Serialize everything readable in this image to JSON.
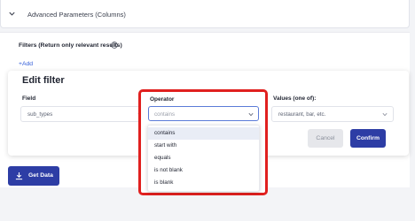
{
  "advanced_parameters": {
    "label": "Advanced Parameters (Columns)"
  },
  "filters": {
    "title": "Filters (Return only relevant results)",
    "add_label": "+Add"
  },
  "modal": {
    "title": "Edit filter",
    "field": {
      "label": "Field",
      "value": "sub_types"
    },
    "operator": {
      "label": "Operator",
      "placeholder": "contains",
      "options": [
        "contains",
        "start with",
        "equals",
        "is not blank",
        "is blank"
      ],
      "highlighted_option": "contains"
    },
    "values": {
      "label": "Values (one of):",
      "value": "restaurant, bar, etc."
    },
    "cancel_label": "Cancel",
    "confirm_label": "Confirm"
  },
  "get_data": {
    "label": "Get Data"
  },
  "colors": {
    "primary": "#2d3da5",
    "highlight_border": "#e0201f",
    "link": "#2f5bd8",
    "disabled_bg": "#e6e7eb"
  },
  "icons": [
    "chevron-down-icon",
    "info-icon",
    "download-icon"
  ]
}
